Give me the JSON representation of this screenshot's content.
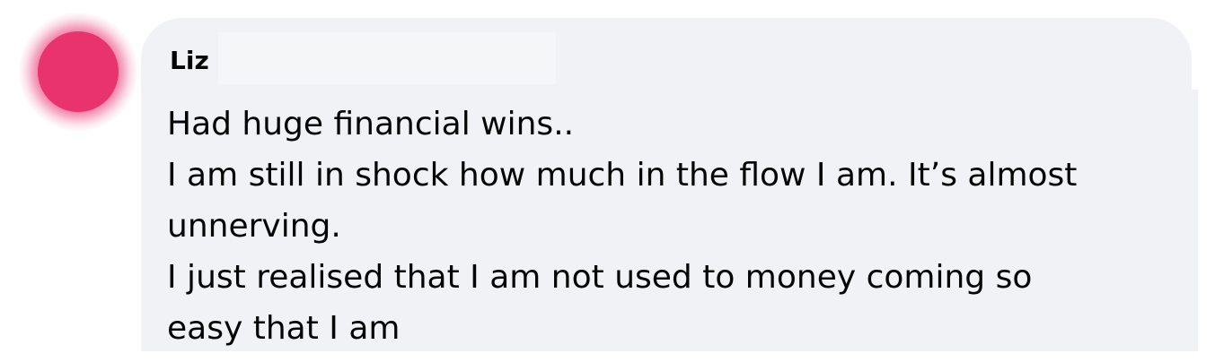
{
  "comment": {
    "author": "Liz",
    "lines": [
      "Had huge financial wins..",
      "I am still in shock how much in the flow I am. It’s almost",
      "unnerving.",
      "I just realised that I am not used to money coming so",
      "easy that I am"
    ]
  },
  "colors": {
    "avatar": "#e8336f",
    "bubble_background": "#f0f2f5",
    "text": "#050505"
  }
}
